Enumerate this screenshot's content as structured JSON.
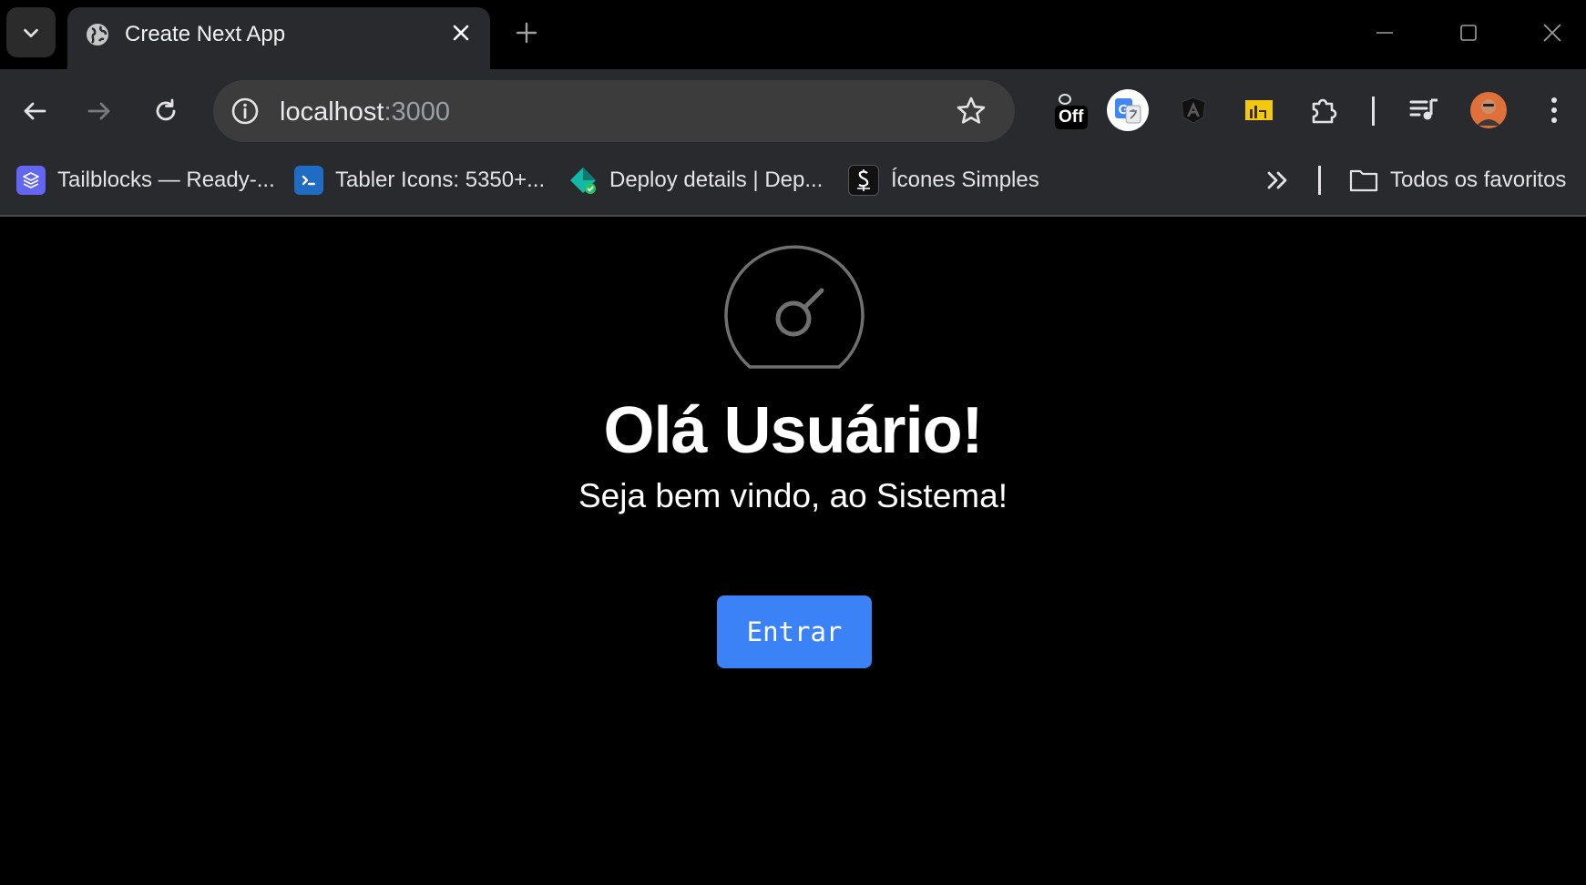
{
  "browser": {
    "tab": {
      "title": "Create Next App"
    },
    "address": {
      "host": "localhost",
      "port": ":3000"
    },
    "extensions": {
      "off_badge": "Off"
    },
    "bookmarks": [
      {
        "label": "Tailblocks — Ready-...",
        "icon": "layers-icon",
        "color": "#6366f1"
      },
      {
        "label": "Tabler Icons: 5350+...",
        "icon": "terminal-icon",
        "color": "#206bc4"
      },
      {
        "label": "Deploy details | Dep...",
        "icon": "netlify-icon",
        "color": "#14b8a6"
      },
      {
        "label": "Ícones Simples",
        "icon": "simple-icons-icon",
        "color": "#111111"
      }
    ],
    "all_bookmarks_label": "Todos os favoritos"
  },
  "page": {
    "headline": "Olá Usuário!",
    "subline": "Seja bem vindo, ao Sistema!",
    "enter_button": "Entrar",
    "accent": "#3b82f6",
    "hero_icon": "gauge-icon"
  }
}
